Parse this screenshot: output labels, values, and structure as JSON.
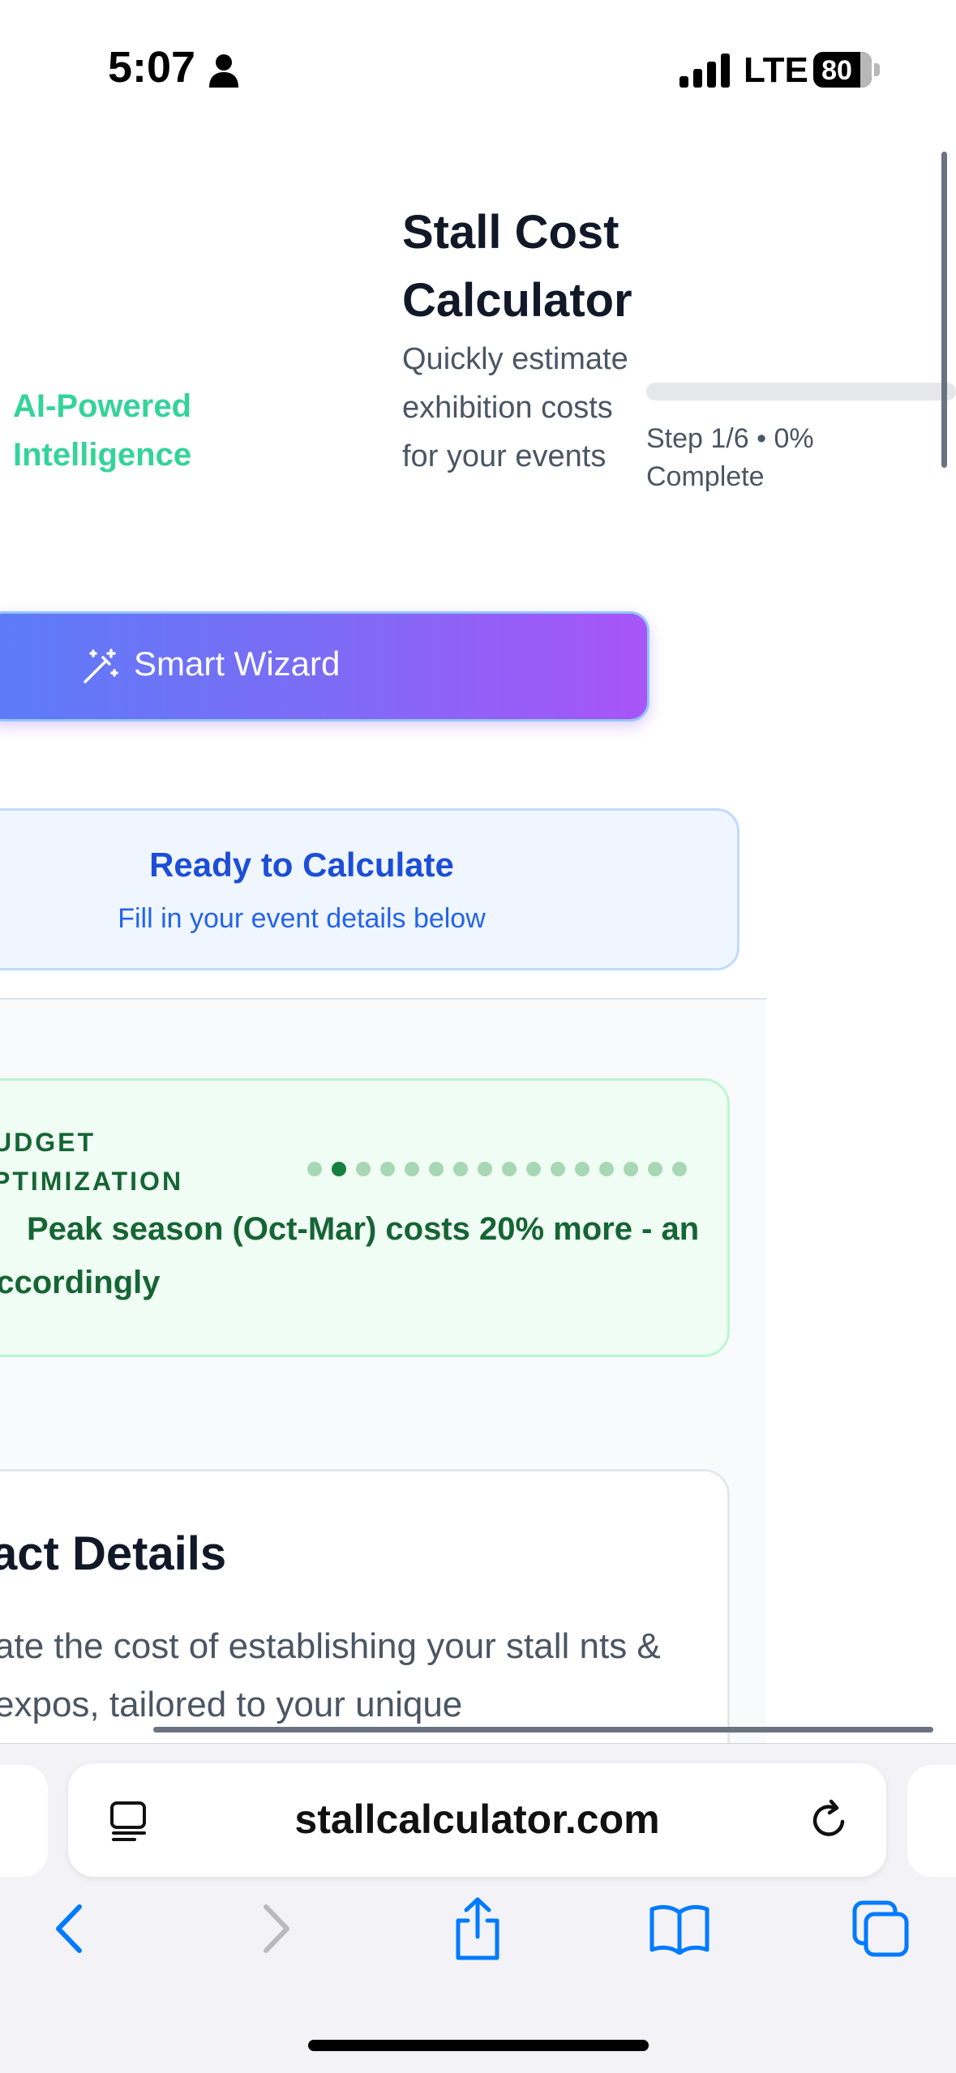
{
  "status_bar": {
    "time": "5:07",
    "network": "LTE",
    "battery": "80",
    "battery_level": 0.8
  },
  "header": {
    "ai_label": "AI-Powered Intelligence",
    "title": "Stall Cost Calculator",
    "subtitle": "Quickly estimate exhibition costs for your events",
    "progress_text": "Step 1/6 • 0% Complete",
    "progress_value": 0,
    "wizard_button": "Smart Wizard"
  },
  "ready": {
    "title": "Ready to Calculate",
    "subtitle": "Fill in your event details below"
  },
  "tip": {
    "heading": "UDGET PTIMIZATION",
    "text": "Peak season (Oct-Mar) costs 20% more - an accordingly",
    "dot_count": 16,
    "active_dot": 1
  },
  "details": {
    "title": "act Details",
    "body": "ate the cost of establishing your stall nts & expos, tailored to your unique"
  },
  "browser": {
    "url": "stallcalculator.com"
  },
  "icons": {
    "person": "person-icon",
    "signal": "signal-icon",
    "battery": "battery-icon",
    "wand": "magic-wand-icon",
    "bulb": "lightbulb-icon",
    "reader": "reader-mode-icon",
    "reload": "reload-icon",
    "back": "back-icon",
    "forward": "forward-icon",
    "share": "share-icon",
    "bookmarks": "bookmarks-icon",
    "tabs": "tabs-icon"
  },
  "colors": {
    "accent_blue": "#1d4ed8",
    "ai_green": "#34d399",
    "tip_green": "#166534",
    "wizard_start": "#5b7cf8",
    "wizard_end": "#a855f7",
    "ios_blue": "#007aff"
  }
}
